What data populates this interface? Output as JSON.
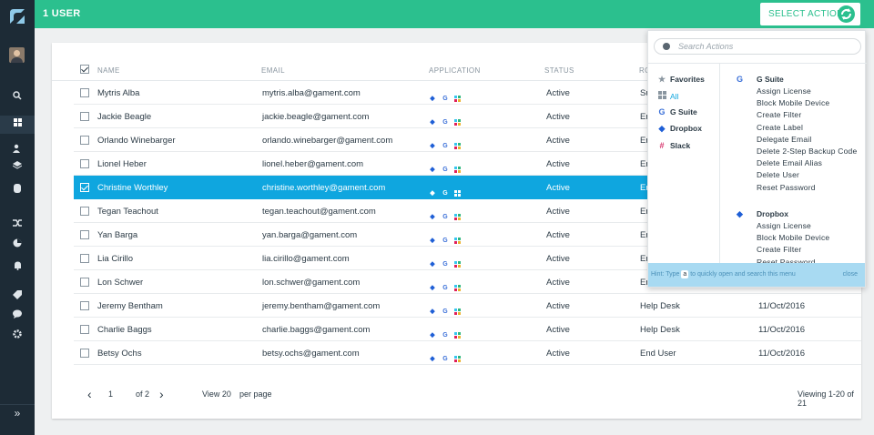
{
  "header": {
    "title": "1 USER",
    "select_action_label": "SELECT ACTION"
  },
  "sidebar": {
    "icons": [
      "search-icon",
      "apps-grid-icon",
      "users-icon",
      "layers-icon",
      "database-icon",
      "shuffle-icon",
      "pie-chart-icon",
      "bell-icon",
      "tag-icon",
      "chat-icon",
      "gear-icon"
    ],
    "expand": "»"
  },
  "table": {
    "columns": [
      "NAME",
      "EMAIL",
      "APPLICATION",
      "STATUS",
      "RO"
    ],
    "rows": [
      {
        "name": "Mytris Alba",
        "email": "mytris.alba@gament.com",
        "status": "Active",
        "role": "Su",
        "date": "",
        "checked": false
      },
      {
        "name": "Jackie Beagle",
        "email": "jackie.beagle@gament.com",
        "status": "Active",
        "role": "En",
        "date": "",
        "checked": false
      },
      {
        "name": "Orlando Winebarger",
        "email": "orlando.winebarger@gament.com",
        "status": "Active",
        "role": "En",
        "date": "",
        "checked": false
      },
      {
        "name": "Lionel Heber",
        "email": "lionel.heber@gament.com",
        "status": "Active",
        "role": "En",
        "date": "",
        "checked": false
      },
      {
        "name": "Christine Worthley",
        "email": "christine.worthley@gament.com",
        "status": "Active",
        "role": "En",
        "date": "",
        "checked": true
      },
      {
        "name": "Tegan Teachout",
        "email": "tegan.teachout@gament.com",
        "status": "Active",
        "role": "En",
        "date": "",
        "checked": false
      },
      {
        "name": "Yan Barga",
        "email": "yan.barga@gament.com",
        "status": "Active",
        "role": "En",
        "date": "",
        "checked": false
      },
      {
        "name": "Lia Cirillo",
        "email": "lia.cirillo@gament.com",
        "status": "Active",
        "role": "En",
        "date": "",
        "checked": false
      },
      {
        "name": "Lon Schwer",
        "email": "lon.schwer@gament.com",
        "status": "Active",
        "role": "En",
        "date": "",
        "checked": false
      },
      {
        "name": "Jeremy Bentham",
        "email": "jeremy.bentham@gament.com",
        "status": "Active",
        "role": "Help Desk",
        "date": "11/Oct/2016",
        "checked": false
      },
      {
        "name": "Charlie Baggs",
        "email": "charlie.baggs@gament.com",
        "status": "Active",
        "role": "Help Desk",
        "date": "11/Oct/2016",
        "checked": false
      },
      {
        "name": "Betsy Ochs",
        "email": "betsy.ochs@gament.com",
        "status": "Active",
        "role": "End User",
        "date": "11/Oct/2016",
        "checked": false
      }
    ]
  },
  "pager": {
    "page": "1",
    "of": "of 2",
    "view": "View 20",
    "per_page": "per page",
    "viewing": "Viewing 1-20 of 21"
  },
  "actions_menu": {
    "search_placeholder": "Search Actions",
    "categories": [
      {
        "label": "Favorites",
        "icon": "star-icon",
        "active": false
      },
      {
        "label": "All",
        "icon": "grid-icon",
        "active": true
      },
      {
        "label": "G Suite",
        "icon": "google-icon",
        "active": false
      },
      {
        "label": "Dropbox",
        "icon": "dropbox-icon",
        "active": false
      },
      {
        "label": "Slack",
        "icon": "slack-icon",
        "active": false
      }
    ],
    "groups": [
      {
        "title": "G Suite",
        "actions": [
          "Assign License",
          "Block Mobile Device",
          "Create Filter",
          "Create Label",
          "Delegate Email",
          "Delete 2-Step Backup Code",
          "Delete Email Alias",
          "Delete User",
          "Reset Password"
        ]
      },
      {
        "title": "Dropbox",
        "actions": [
          "Assign License",
          "Block Mobile Device",
          "Create Filter",
          "Reset Password"
        ]
      }
    ],
    "hint_pre": "Hint: Type",
    "hint_key": "a",
    "hint_post": "to quickly open and search this menu",
    "close": "close"
  },
  "colors": {
    "accent": "#2bc08e",
    "selected": "#0fa6df",
    "sidebar": "#1d2b36"
  }
}
